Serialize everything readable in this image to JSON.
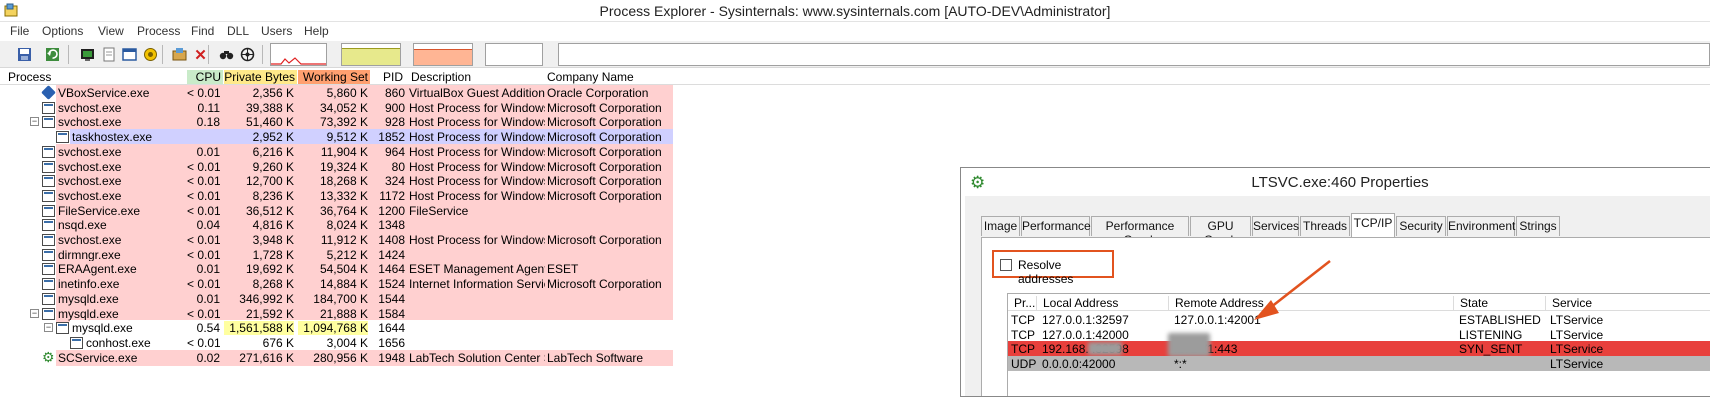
{
  "window": {
    "title": "Process Explorer - Sysinternals: www.sysinternals.com [AUTO-DEV\\Administrator]"
  },
  "menu": [
    "File",
    "Options",
    "View",
    "Process",
    "Find",
    "DLL",
    "Users",
    "Help"
  ],
  "toolbar": {
    "buttons": [
      "save-icon",
      "refresh-icon",
      "system-info-icon",
      "properties-icon",
      "window-icon",
      "target-icon",
      "options-icon",
      "kill-process-icon",
      "find-icon",
      "dll-icon"
    ]
  },
  "columns": {
    "process": "Process",
    "cpu": "CPU",
    "private_bytes": "Private Bytes",
    "working_set": "Working Set",
    "pid": "PID",
    "description": "Description",
    "company": "Company Name"
  },
  "colors": {
    "service_row": "#ffd0d0",
    "own_row": "#d0d0ff",
    "cpu_header": "#c9ebc9",
    "private_bytes_header": "#ffe98a",
    "working_set_header": "#ffa070",
    "highlight_cell": "#ffffa0",
    "syn_sent_row": "#e8403c",
    "udp_row": "#b8b8b8",
    "callout": "#e2531f"
  },
  "processes": [
    {
      "name": "VBoxService.exe",
      "cpu": "< 0.01",
      "private": "2,356 K",
      "working": "5,860 K",
      "pid": "860",
      "desc": "VirtualBox Guest Additions S...",
      "company": "Oracle Corporation",
      "indent": 3,
      "bg": "service",
      "icon": "vbox",
      "exp": ""
    },
    {
      "name": "svchost.exe",
      "cpu": "0.11",
      "private": "39,388 K",
      "working": "34,052 K",
      "pid": "900",
      "desc": "Host Process for Windows S...",
      "company": "Microsoft Corporation",
      "indent": 3,
      "bg": "service",
      "icon": "win",
      "exp": ""
    },
    {
      "name": "svchost.exe",
      "cpu": "0.18",
      "private": "51,460 K",
      "working": "73,392 K",
      "pid": "928",
      "desc": "Host Process for Windows S...",
      "company": "Microsoft Corporation",
      "indent": 3,
      "bg": "service",
      "icon": "win",
      "exp": "−"
    },
    {
      "name": "taskhostex.exe",
      "cpu": "",
      "private": "2,952 K",
      "working": "9,512 K",
      "pid": "1852",
      "desc": "Host Process for Windows T...",
      "company": "Microsoft Corporation",
      "indent": 4,
      "bg": "own",
      "icon": "win",
      "exp": ""
    },
    {
      "name": "svchost.exe",
      "cpu": "0.01",
      "private": "6,216 K",
      "working": "11,904 K",
      "pid": "964",
      "desc": "Host Process for Windows S...",
      "company": "Microsoft Corporation",
      "indent": 3,
      "bg": "service",
      "icon": "win",
      "exp": ""
    },
    {
      "name": "svchost.exe",
      "cpu": "< 0.01",
      "private": "9,260 K",
      "working": "19,324 K",
      "pid": "80",
      "desc": "Host Process for Windows S...",
      "company": "Microsoft Corporation",
      "indent": 3,
      "bg": "service",
      "icon": "win",
      "exp": ""
    },
    {
      "name": "svchost.exe",
      "cpu": "< 0.01",
      "private": "12,700 K",
      "working": "18,268 K",
      "pid": "324",
      "desc": "Host Process for Windows S...",
      "company": "Microsoft Corporation",
      "indent": 3,
      "bg": "service",
      "icon": "win",
      "exp": ""
    },
    {
      "name": "svchost.exe",
      "cpu": "< 0.01",
      "private": "8,236 K",
      "working": "13,332 K",
      "pid": "1172",
      "desc": "Host Process for Windows S...",
      "company": "Microsoft Corporation",
      "indent": 3,
      "bg": "service",
      "icon": "win",
      "exp": ""
    },
    {
      "name": "FileService.exe",
      "cpu": "< 0.01",
      "private": "36,512 K",
      "working": "36,764 K",
      "pid": "1200",
      "desc": "FileService",
      "company": "",
      "indent": 3,
      "bg": "service",
      "icon": "win",
      "exp": ""
    },
    {
      "name": "nsqd.exe",
      "cpu": "0.04",
      "private": "4,816 K",
      "working": "8,024 K",
      "pid": "1348",
      "desc": "",
      "company": "",
      "indent": 3,
      "bg": "service",
      "icon": "win",
      "exp": ""
    },
    {
      "name": "svchost.exe",
      "cpu": "< 0.01",
      "private": "3,948 K",
      "working": "11,912 K",
      "pid": "1408",
      "desc": "Host Process for Windows S...",
      "company": "Microsoft Corporation",
      "indent": 3,
      "bg": "service",
      "icon": "win",
      "exp": ""
    },
    {
      "name": "dirmngr.exe",
      "cpu": "< 0.01",
      "private": "1,728 K",
      "working": "5,212 K",
      "pid": "1424",
      "desc": "",
      "company": "",
      "indent": 3,
      "bg": "service",
      "icon": "win",
      "exp": ""
    },
    {
      "name": "ERAAgent.exe",
      "cpu": "0.01",
      "private": "19,692 K",
      "working": "54,504 K",
      "pid": "1464",
      "desc": "ESET Management Agent M...",
      "company": "ESET",
      "indent": 3,
      "bg": "service",
      "icon": "win",
      "exp": ""
    },
    {
      "name": "inetinfo.exe",
      "cpu": "< 0.01",
      "private": "8,268 K",
      "working": "14,884 K",
      "pid": "1524",
      "desc": "Internet Information Services",
      "company": "Microsoft Corporation",
      "indent": 3,
      "bg": "service",
      "icon": "win",
      "exp": ""
    },
    {
      "name": "mysqld.exe",
      "cpu": "0.01",
      "private": "346,992 K",
      "working": "184,700 K",
      "pid": "1544",
      "desc": "",
      "company": "",
      "indent": 3,
      "bg": "service",
      "icon": "win",
      "exp": ""
    },
    {
      "name": "mysqld.exe",
      "cpu": "< 0.01",
      "private": "21,592 K",
      "working": "21,888 K",
      "pid": "1584",
      "desc": "",
      "company": "",
      "indent": 3,
      "bg": "service",
      "icon": "win",
      "exp": "−"
    },
    {
      "name": "mysqld.exe",
      "cpu": "0.54",
      "private": "1,561,588 K",
      "working": "1,094,768 K",
      "pid": "1644",
      "desc": "",
      "company": "",
      "indent": 4,
      "bg": "none",
      "icon": "win",
      "exp": "−",
      "hl": true
    },
    {
      "name": "conhost.exe",
      "cpu": "< 0.01",
      "private": "676 K",
      "working": "3,004 K",
      "pid": "1656",
      "desc": "",
      "company": "",
      "indent": 5,
      "bg": "none",
      "icon": "win",
      "exp": ""
    },
    {
      "name": "SCService.exe",
      "cpu": "0.02",
      "private": "271,616 K",
      "working": "280,956 K",
      "pid": "1948",
      "desc": "LabTech Solution Center Ser...",
      "company": "LabTech Software",
      "indent": 3,
      "bg": "service",
      "icon": "gear",
      "exp": ""
    }
  ],
  "properties": {
    "title": "LTSVC.exe:460 Properties",
    "tabs": [
      "Image",
      "Performance",
      "Performance Graph",
      "GPU Graph",
      "Services",
      "Threads",
      "TCP/IP",
      "Security",
      "Environment",
      "Strings"
    ],
    "active_tab": "TCP/IP",
    "resolve_label": "Resolve addresses",
    "resolve_checked": false,
    "conn_headers": [
      "Pr...",
      "Local Address",
      "Remote Address",
      "State",
      "Service"
    ],
    "connections": [
      {
        "proto": "TCP",
        "local": "127.0.0.1:32597",
        "remote": "127.0.0.1:42001",
        "state": "ESTABLISHED",
        "service": "LTService",
        "style": "none"
      },
      {
        "proto": "TCP",
        "local": "127.0.0.1:42000",
        "remote": "",
        "state": "LISTENING",
        "service": "LTService",
        "style": "none"
      },
      {
        "proto": "TCP",
        "local": "192.168.          :32598",
        "remote": "            .172.71:443",
        "state": "SYN_SENT",
        "service": "LTService",
        "style": "syn"
      },
      {
        "proto": "UDP",
        "local": "0.0.0.0:42000",
        "remote": "*:*",
        "state": "",
        "service": "LTService",
        "style": "udp"
      }
    ]
  }
}
